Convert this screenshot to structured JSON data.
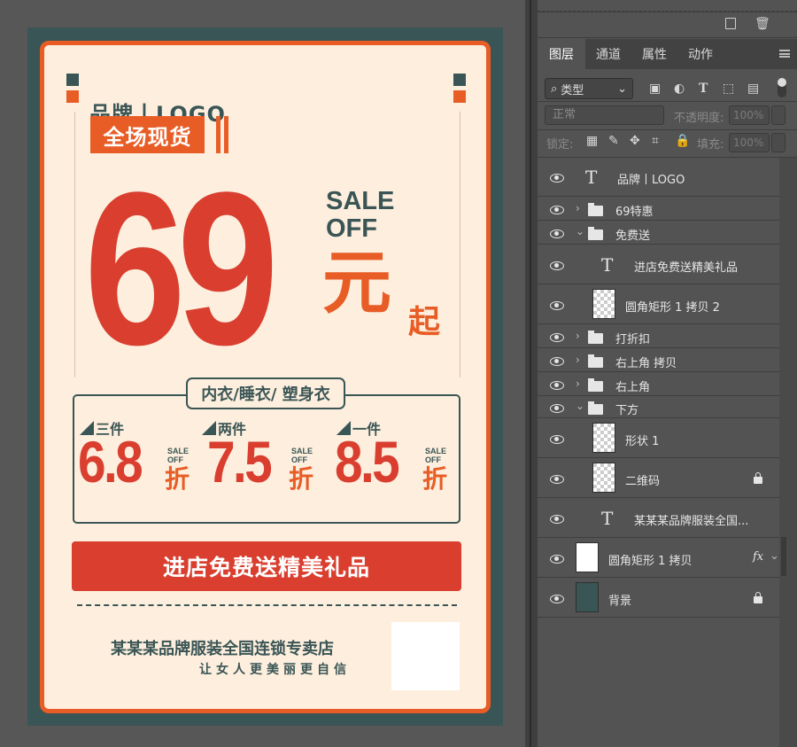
{
  "poster": {
    "brand": "品牌丨LOGO",
    "tag": "全场现货",
    "price": "69",
    "sale_line1": "SALE",
    "sale_line2": "OFF",
    "yuan": "元",
    "qi": "起",
    "category_label": "内衣/睡衣/ 塑身衣",
    "discounts": [
      {
        "label": "三件",
        "value": "6.8",
        "sale": "SALE",
        "off": "OFF",
        "unit": "折"
      },
      {
        "label": "两件",
        "value": "7.5",
        "sale": "SALE",
        "off": "OFF",
        "unit": "折"
      },
      {
        "label": "一件",
        "value": "8.5",
        "sale": "SALE",
        "off": "OFF",
        "unit": "折"
      }
    ],
    "gift_button": "进店免费送精美礼品",
    "store_name": "某某某品牌服装全国连锁专卖店",
    "slogan": "让女人更美丽更自信",
    "colors": {
      "background": "#3a5555",
      "paper": "#fdeedd",
      "orange": "#e85d26",
      "red": "#d93e2f"
    }
  },
  "panel": {
    "tabs": [
      "图层",
      "通道",
      "属性",
      "动作"
    ],
    "active_tab": "图层",
    "filter_kind": "类型",
    "blend_mode": "正常",
    "opacity_label": "不透明度:",
    "opacity_value": "100%",
    "lock_label": "锁定:",
    "fill_label": "填充:",
    "fill_value": "100%",
    "layers": [
      {
        "name": "品牌丨LOGO",
        "kind": "text"
      },
      {
        "name": "69特惠",
        "kind": "group",
        "expanded": false
      },
      {
        "name": "免费送",
        "kind": "group",
        "expanded": true
      },
      {
        "name": "进店免费送精美礼品",
        "kind": "text"
      },
      {
        "name": "圆角矩形 1 拷贝 2",
        "kind": "shape"
      },
      {
        "name": "打折扣",
        "kind": "group",
        "expanded": false
      },
      {
        "name": "右上角 拷贝",
        "kind": "group",
        "expanded": false
      },
      {
        "name": "右上角",
        "kind": "group",
        "expanded": false
      },
      {
        "name": "下方",
        "kind": "group",
        "expanded": true
      },
      {
        "name": "形状 1",
        "kind": "shape"
      },
      {
        "name": "二维码",
        "kind": "pixel",
        "locked": true
      },
      {
        "name": "某某某品牌服装全国...",
        "kind": "text"
      },
      {
        "name": "圆角矩形 1 拷贝",
        "kind": "shape",
        "fx": "fx"
      },
      {
        "name": "背景",
        "kind": "background",
        "locked": true
      }
    ]
  }
}
